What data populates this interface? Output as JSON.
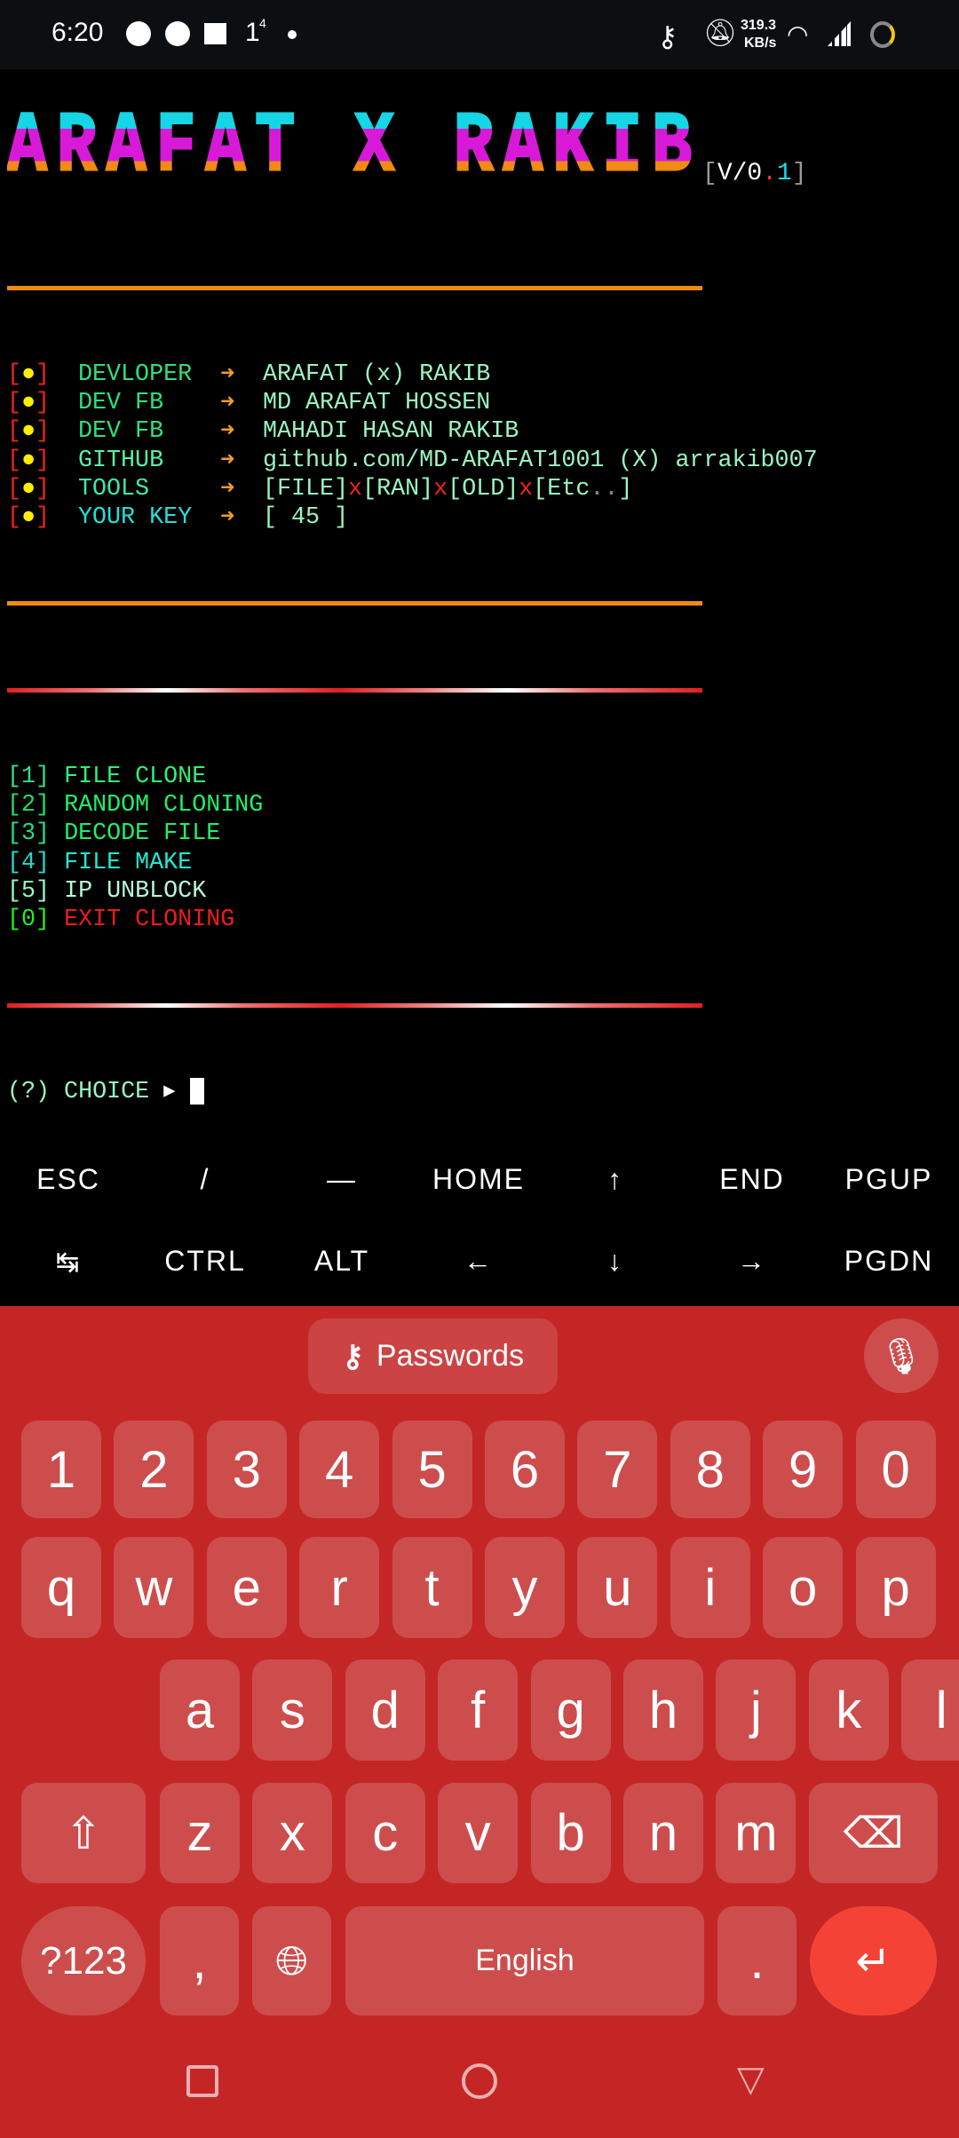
{
  "status": {
    "time": "6:20",
    "notif_count": "1",
    "notif_sup": "4",
    "net_speed": "319.3",
    "net_unit": "KB/s"
  },
  "banner": {
    "title": "ARAFAT X RAKIB",
    "version_prefix": "V/0",
    "version_dot": ".",
    "version_suffix": "1"
  },
  "info": [
    {
      "label": "DEVLOPER",
      "value": "ARAFAT (x) RAKIB",
      "color": "#2fe07a"
    },
    {
      "label": "DEV FB",
      "value": "MD ARAFAT HOSSEN",
      "color": "#2fe07a"
    },
    {
      "label": "DEV FB",
      "value": "MAHADI HASAN RAKIB",
      "color": "#2fe07a"
    },
    {
      "label": "GITHUB",
      "value": "github.com/MD-ARAFAT1001 (X) arrakib007",
      "color": "#5af0a0"
    },
    {
      "label": "TOOLS",
      "value": "",
      "color": "#3fe8b0"
    },
    {
      "label": "YOUR KEY",
      "value": "[ 45 ]",
      "color": "#22e0d8"
    }
  ],
  "tools": {
    "a": "[FILE]",
    "x": "x",
    "b": "[RAN]",
    "c": "[OLD]",
    "d": "[Etc",
    "dots": "..",
    "e": "]"
  },
  "arrow": "➜",
  "menu": [
    {
      "num": "[1]",
      "label": "FILE CLONE",
      "color": "#33ee77",
      "ncolor": "#33dd88"
    },
    {
      "num": "[2]",
      "label": "RANDOM CLONING",
      "color": "#22ee66",
      "ncolor": "#22dd66"
    },
    {
      "num": "[3]",
      "label": "DECODE FILE",
      "color": "#22ee66",
      "ncolor": "#22dd88"
    },
    {
      "num": "[4]",
      "label": "FILE MAKE",
      "color": "#22e8d0",
      "ncolor": "#22d8c8"
    },
    {
      "num": "[5]",
      "label": "IP UNBLOCK",
      "color": "#b8f8d8",
      "ncolor": "#9af5c0"
    },
    {
      "num": "[0]",
      "label": "EXIT CLONING",
      "color": "#ee1c1c",
      "ncolor": "#22ee22"
    }
  ],
  "prompt": {
    "text": "(?) CHOICE",
    "arrow": "▸"
  },
  "extra_keys": [
    [
      "ESC",
      "/",
      "—",
      "HOME",
      "↑",
      "END",
      "PGUP"
    ],
    [
      "↹",
      "CTRL",
      "ALT",
      "←",
      "↓",
      "→",
      "PGDN"
    ]
  ],
  "keyboard": {
    "suggestion": "Passwords",
    "rows": [
      [
        "1",
        "2",
        "3",
        "4",
        "5",
        "6",
        "7",
        "8",
        "9",
        "0"
      ],
      [
        "q",
        "w",
        "e",
        "r",
        "t",
        "y",
        "u",
        "i",
        "o",
        "p"
      ],
      [
        "a",
        "s",
        "d",
        "f",
        "g",
        "h",
        "j",
        "k",
        "l"
      ],
      [
        "z",
        "x",
        "c",
        "v",
        "b",
        "n",
        "m"
      ]
    ],
    "symbols": "?123",
    "comma": ",",
    "space": "English",
    "period": "."
  },
  "colors": {
    "keyboard_bg": "#c42626",
    "key_bg": "#cd4d4d",
    "enter": "#f44336"
  }
}
